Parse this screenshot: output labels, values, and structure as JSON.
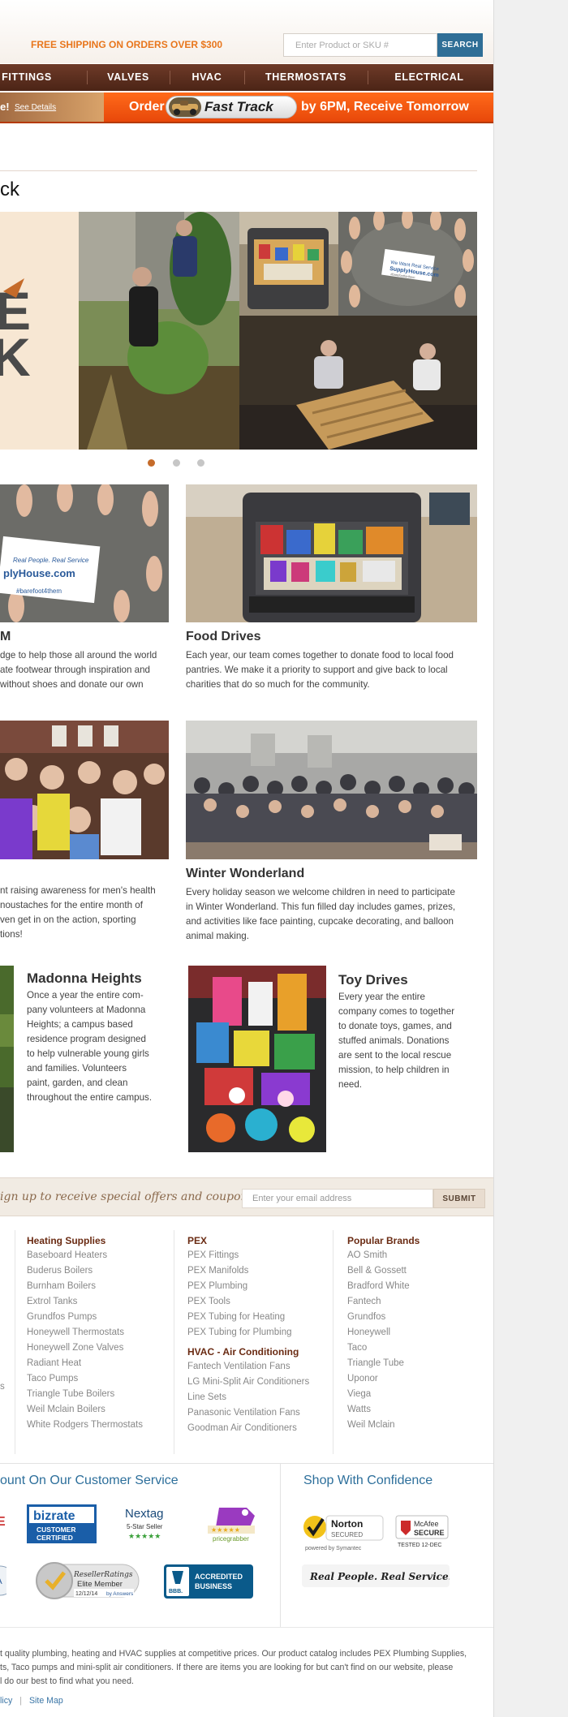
{
  "header": {
    "shipping": "FREE SHIPPING ON ORDERS OVER $300",
    "search_placeholder": "Enter Product or SKU #",
    "search_button": "SEARCH"
  },
  "nav": {
    "items": [
      "FITTINGS",
      "VALVES",
      "HVAC",
      "THERMOSTATS",
      "ELECTRICAL"
    ]
  },
  "promo": {
    "left_text": "e!",
    "details": "See Details",
    "order": "Order",
    "fast_track": "Fast Track",
    "by": "by 6PM, Receive Tomorrow"
  },
  "page": {
    "title": "ck",
    "hero_text": "E\nK"
  },
  "hero_badge": {
    "line1": "We Want Real Service",
    "line2": "SupplyHouse.com",
    "line3": "#barefootforthem"
  },
  "cards": {
    "toms": {
      "title": "M",
      "text1": "dge to help those all around the world",
      "text2": "ate footwear through inspiration and",
      "text3": "without shoes and donate our own",
      "badge1": "Real People. Real Service",
      "badge2": "plyHouse.com",
      "badge3": "#barefoot4them"
    },
    "food": {
      "title": "Food Drives",
      "text1": "Each year, our team comes together to donate food to local food",
      "text2": "pantries.  We make it a priority to support and give back to local",
      "text3": "charities that do so much for the community."
    },
    "movember": {
      "text1": "nt raising awareness for men's health",
      "text2": "noustaches for the entire month of",
      "text3": "ven get in on the action, sporting",
      "text4": "tions!"
    },
    "winter": {
      "title": "Winter Wonderland",
      "text1": "Every holiday season we welcome children in need to participate",
      "text2": "in Winter Wonderland. This fun filled day includes games, prizes,",
      "text3": "and activities like face painting, cupcake decorating, and balloon",
      "text4": "animal making."
    },
    "madonna": {
      "title": "Madonna Heights",
      "lines": [
        "Once a year the entire com-",
        "pany volunteers at Madonna",
        "Heights; a campus based",
        "residence program designed",
        "to help vulnerable young girls",
        "and families.  Volunteers",
        "paint, garden, and clean",
        "throughout the entire campus."
      ]
    },
    "toy": {
      "title": "Toy Drives",
      "lines": [
        "Every year the entire",
        "company comes to together",
        "to donate toys, games, and",
        "stuffed animals. Donations",
        "are sent to the local rescue",
        "mission, to help children in",
        "need."
      ]
    }
  },
  "signup": {
    "text": "ign up to receive special offers and coupons",
    "placeholder": "Enter your email address",
    "button": "SUBMIT"
  },
  "links": {
    "col_left": [
      "s"
    ],
    "heating": {
      "title": "Heating Supplies",
      "items": [
        "Baseboard Heaters",
        "Buderus Boilers",
        "Burnham Boilers",
        "Extrol Tanks",
        "Grundfos Pumps",
        "Honeywell Thermostats",
        "Honeywell Zone Valves",
        "Radiant Heat",
        "Taco Pumps",
        "Triangle Tube Boilers",
        "Weil Mclain Boilers",
        "White Rodgers Thermostats"
      ]
    },
    "pex": {
      "title": "PEX",
      "items": [
        "PEX Fittings",
        "PEX Manifolds",
        "PEX Plumbing",
        "PEX Tools",
        "PEX Tubing for Heating",
        "PEX Tubing for Plumbing"
      ]
    },
    "hvac": {
      "title": "HVAC - Air Conditioning",
      "items": [
        "Fantech Ventilation Fans",
        "LG Mini-Split Air Conditioners",
        "Line Sets",
        "Panasonic Ventilation Fans",
        "Goodman Air Conditioners"
      ]
    },
    "brands": {
      "title": "Popular Brands",
      "items": [
        "AO Smith",
        "Bell & Gossett",
        "Bradford White",
        "Fantech",
        "Grundfos",
        "Honeywell",
        "Taco",
        "Triangle Tube",
        "Uponor",
        "Viega",
        "Watts",
        "Weil Mclain"
      ]
    }
  },
  "trust": {
    "left_title": "ount On Our Customer Service",
    "right_title": "Shop With Confidence",
    "bizrate_1": "bizrate",
    "bizrate_2": "CUSTOMER",
    "bizrate_3": "CERTIFIED",
    "nextag_1": "Nextag",
    "nextag_2": "5-Star Seller",
    "nextag_3": "★★★★★",
    "pricegrabber_1": "★★★★★",
    "pricegrabber_2": "pricegrabber",
    "reseller_1": "ResellerRatings",
    "reseller_2": "Elite Member",
    "reseller_3": "12/12/14",
    "reseller_4": "by Answers",
    "bbb_1": "ACCREDITED",
    "bbb_2": "BUSINESS",
    "bbb_3": "BBB.",
    "norton_1": "Norton",
    "norton_2": "SECURED",
    "norton_3": "powered by Symantec",
    "mcafee_1": "McAfee",
    "mcafee_2": "SECURE",
    "mcafee_3": "TESTED 12-DEC",
    "real_people": "Real People. Real Service.",
    "left_stub_a": "E",
    "left_stub_b": "A"
  },
  "footer": {
    "line1": "t quality plumbing, heating and HVAC supplies at competitive prices. Our product catalog includes PEX Plumbing Supplies,",
    "line2": "ts, Taco pumps and mini-split air conditioners. If there are items you are looking for but can't find on our website, please",
    "line3": "l do our best to find what you need.",
    "link1": "licy",
    "sep": "|",
    "link2": "Site Map"
  },
  "colors": {
    "accent_orange": "#e8761c",
    "nav_brown": "#5a2d1c",
    "link_blue": "#2d6f9b",
    "heading_brown": "#6a2b13"
  }
}
